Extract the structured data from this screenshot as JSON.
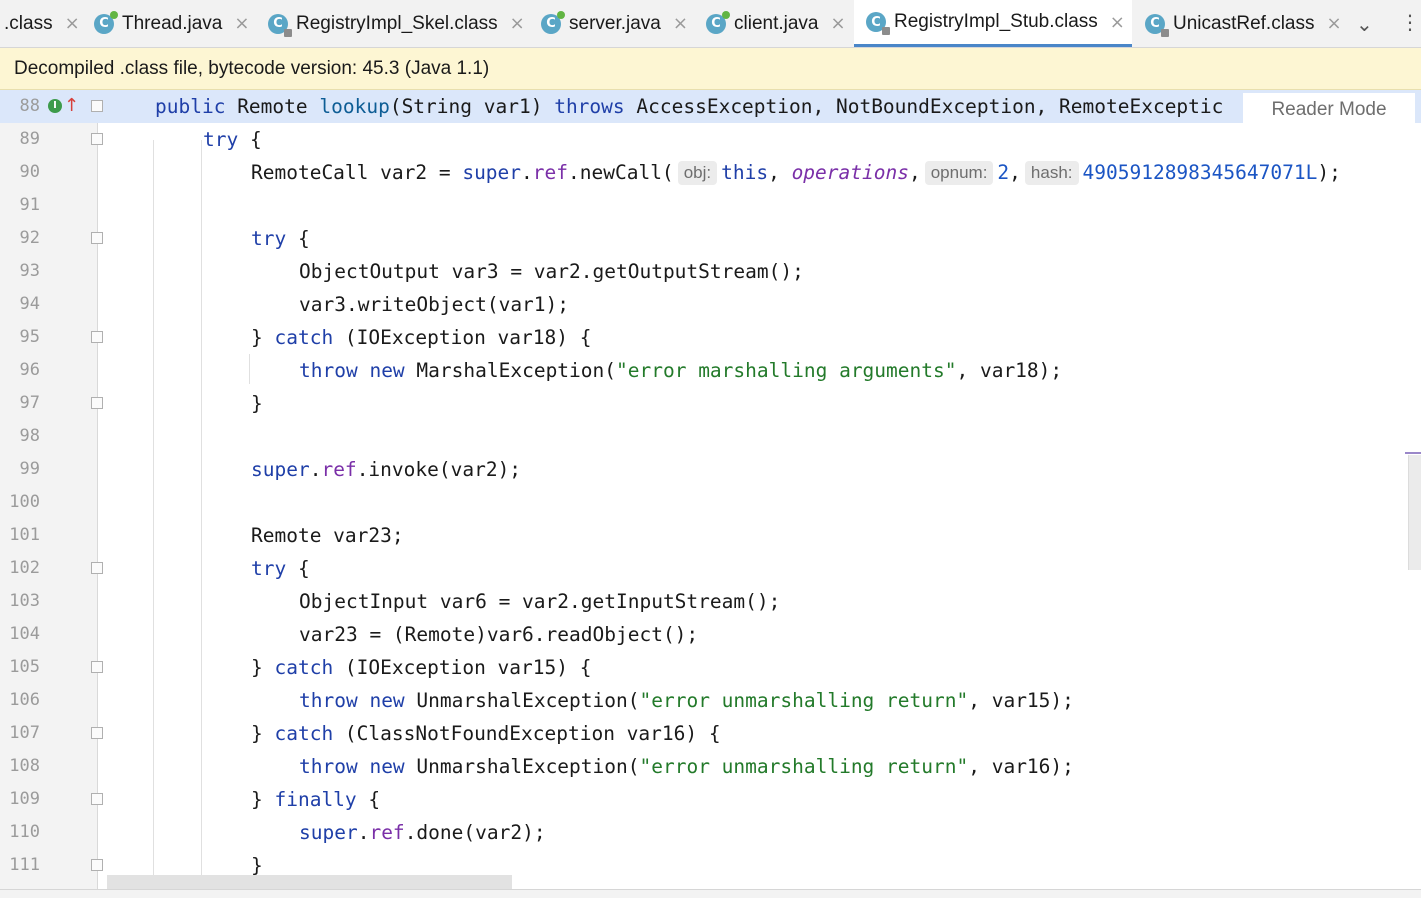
{
  "tabs": [
    {
      "label": ".class",
      "type": "class",
      "active": false
    },
    {
      "label": "Thread.java",
      "type": "java",
      "active": false
    },
    {
      "label": "RegistryImpl_Skel.class",
      "type": "class",
      "active": false
    },
    {
      "label": "server.java",
      "type": "java",
      "active": false
    },
    {
      "label": "client.java",
      "type": "java",
      "active": false
    },
    {
      "label": "RegistryImpl_Stub.class",
      "type": "class",
      "active": true
    },
    {
      "label": "UnicastRef.class",
      "type": "class",
      "active": false
    }
  ],
  "tab_close_glyph": "×",
  "tab_icon_letter": "C",
  "toolbar": {
    "dropdown_icon": "chevron-down-icon",
    "menu_icon": "more-vert-icon"
  },
  "banner": {
    "text": "Decompiled .class file, bytecode version: 45.3 (Java 1.1)"
  },
  "reader_mode": {
    "label": "Reader Mode"
  },
  "gutter_icons": {
    "implementation": "I",
    "override": "↑"
  },
  "editor": {
    "line_numbers": [
      "88",
      "89",
      "90",
      "91",
      "92",
      "93",
      "94",
      "95",
      "96",
      "97",
      "98",
      "99",
      "100",
      "101",
      "102",
      "103",
      "104",
      "105",
      "106",
      "107",
      "108",
      "109",
      "110",
      "111"
    ],
    "hints": {
      "obj": "obj:",
      "opnum": "opnum:",
      "hash": "hash:"
    },
    "code": {
      "l88": {
        "kw_public": "public",
        "t1": " Remote ",
        "fn_lookup": "lookup",
        "t2": "(String var1) ",
        "kw_throws": "throws",
        "t3": " AccessException, NotBoundException, RemoteExceptic"
      },
      "l89": {
        "kw_try": "try",
        "t1": " {"
      },
      "l90": {
        "t1": "RemoteCall var2 = ",
        "kw_super": "super",
        "t2": ".",
        "fld_ref": "ref",
        "t3": ".newCall(",
        "kw_this": "this",
        "t4": ", ",
        "it_ops": "operations",
        "t5": ",",
        "num_2": "2",
        "t6": ",",
        "num_hash": "4905912898345647071L",
        "t7": ");"
      },
      "l92": {
        "kw_try": "try",
        "t1": " {"
      },
      "l93": {
        "t1": "ObjectOutput var3 = var2.getOutputStream();"
      },
      "l94": {
        "t1": "var3.writeObject(var1);"
      },
      "l95": {
        "t1": "} ",
        "kw_catch": "catch",
        "t2": " (IOException var18) {"
      },
      "l96": {
        "kw_throw": "throw",
        "t1": " ",
        "kw_new": "new",
        "t2": " MarshalException(",
        "str": "\"error marshalling arguments\"",
        "t3": ", var18);"
      },
      "l97": {
        "t1": "}"
      },
      "l99": {
        "kw_super": "super",
        "t1": ".",
        "fld_ref": "ref",
        "t2": ".invoke(var2);"
      },
      "l101": {
        "t1": "Remote var23;"
      },
      "l102": {
        "kw_try": "try",
        "t1": " {"
      },
      "l103": {
        "t1": "ObjectInput var6 = var2.getInputStream();"
      },
      "l104": {
        "t1": "var23 = (Remote)var6.readObject();"
      },
      "l105": {
        "t1": "} ",
        "kw_catch": "catch",
        "t2": " (IOException var15) {"
      },
      "l106": {
        "kw_throw": "throw",
        "t1": " ",
        "kw_new": "new",
        "t2": " UnmarshalException(",
        "str": "\"error unmarshalling return\"",
        "t3": ", var15);"
      },
      "l107": {
        "t1": "} ",
        "kw_catch": "catch",
        "t2": " (ClassNotFoundException var16) {"
      },
      "l108": {
        "kw_throw": "throw",
        "t1": " ",
        "kw_new": "new",
        "t2": " UnmarshalException(",
        "str": "\"error unmarshalling return\"",
        "t3": ", var16);"
      },
      "l109": {
        "t1": "} ",
        "kw_finally": "finally",
        "t2": " {"
      },
      "l110": {
        "kw_super": "super",
        "t1": ".",
        "fld_ref": "ref",
        "t2": ".done(var2);"
      },
      "l111": {
        "t1": "}"
      }
    }
  }
}
